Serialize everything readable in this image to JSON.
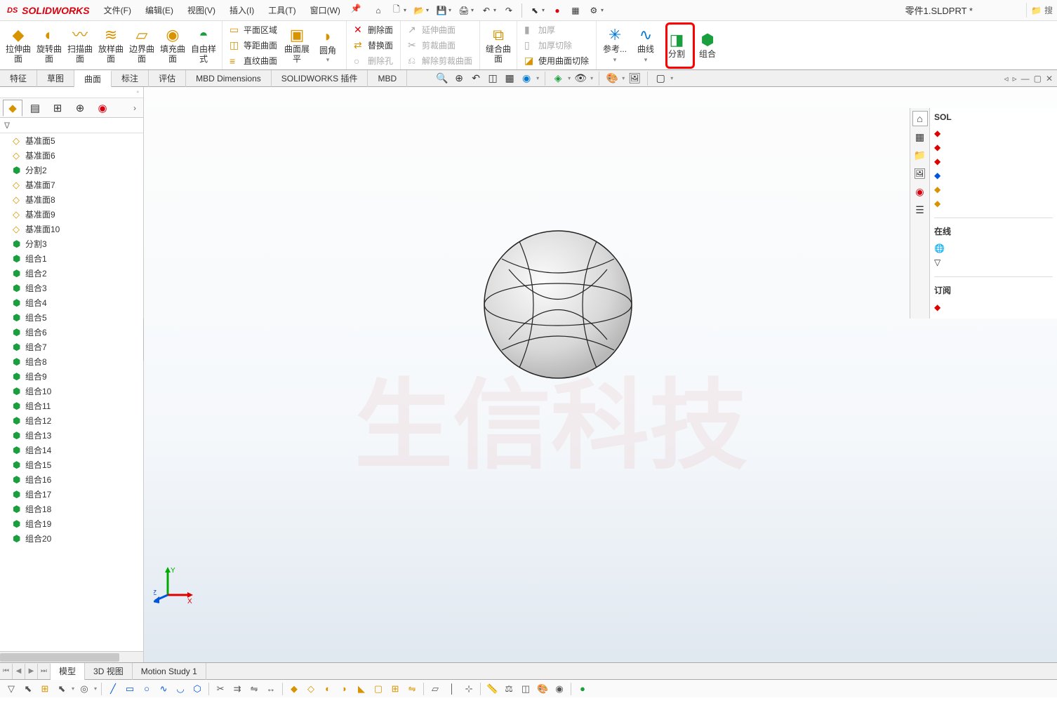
{
  "app": {
    "logo_prefix": "DS",
    "logo_name": "SOLIDWORKS",
    "filename": "零件1.SLDPRT *",
    "search_placeholder": "搜"
  },
  "menus": [
    "文件(F)",
    "编辑(E)",
    "视图(V)",
    "插入(I)",
    "工具(T)",
    "窗口(W)"
  ],
  "ribbon": {
    "group1": [
      {
        "label": "拉伸曲面"
      },
      {
        "label": "旋转曲面"
      },
      {
        "label": "扫描曲面"
      },
      {
        "label": "放样曲面"
      },
      {
        "label": "边界曲面"
      },
      {
        "label": "填充曲面"
      },
      {
        "label": "自由样式"
      }
    ],
    "group2_col": [
      "平面区域",
      "等距曲面",
      "直纹曲面"
    ],
    "group2_big": [
      {
        "label": "曲面展平"
      },
      {
        "label": "圆角"
      }
    ],
    "group3_col": [
      "删除面",
      "替换面",
      "删除孔"
    ],
    "group4_col": [
      "延伸曲面",
      "剪裁曲面",
      "解除剪裁曲面"
    ],
    "group5_big": {
      "label": "缝合曲面"
    },
    "group6_col": [
      "加厚",
      "加厚切除",
      "使用曲面切除"
    ],
    "group7": [
      {
        "label": "参考..."
      },
      {
        "label": "曲线"
      },
      {
        "label": "分割"
      },
      {
        "label": "组合"
      }
    ]
  },
  "cmd_tabs": [
    "特征",
    "草图",
    "曲面",
    "标注",
    "评估",
    "MBD Dimensions",
    "SOLIDWORKS 插件",
    "MBD"
  ],
  "active_cmd_tab": "曲面",
  "tree": [
    {
      "icon": "plane",
      "label": "基准面5"
    },
    {
      "icon": "plane",
      "label": "基准面6"
    },
    {
      "icon": "solid",
      "label": "分割2"
    },
    {
      "icon": "plane",
      "label": "基准面7"
    },
    {
      "icon": "plane",
      "label": "基准面8"
    },
    {
      "icon": "plane",
      "label": "基准面9"
    },
    {
      "icon": "plane",
      "label": "基准面10"
    },
    {
      "icon": "solid",
      "label": "分割3"
    },
    {
      "icon": "solid",
      "label": "组合1"
    },
    {
      "icon": "solid",
      "label": "组合2"
    },
    {
      "icon": "solid",
      "label": "组合3"
    },
    {
      "icon": "solid",
      "label": "组合4"
    },
    {
      "icon": "solid",
      "label": "组合5"
    },
    {
      "icon": "solid",
      "label": "组合6"
    },
    {
      "icon": "solid",
      "label": "组合7"
    },
    {
      "icon": "solid",
      "label": "组合8"
    },
    {
      "icon": "solid",
      "label": "组合9"
    },
    {
      "icon": "solid",
      "label": "组合10"
    },
    {
      "icon": "solid",
      "label": "组合11"
    },
    {
      "icon": "solid",
      "label": "组合12"
    },
    {
      "icon": "solid",
      "label": "组合13"
    },
    {
      "icon": "solid",
      "label": "组合14"
    },
    {
      "icon": "solid",
      "label": "组合15"
    },
    {
      "icon": "solid",
      "label": "组合16"
    },
    {
      "icon": "solid",
      "label": "组合17"
    },
    {
      "icon": "solid",
      "label": "组合18"
    },
    {
      "icon": "solid",
      "label": "组合19"
    },
    {
      "icon": "solid",
      "label": "组合20"
    }
  ],
  "right_pane": {
    "title": "SOL",
    "sections": [
      {
        "title": "在线",
        "items": []
      },
      {
        "title": "订阅",
        "items": []
      }
    ]
  },
  "bottom_tabs": [
    "模型",
    "3D 视图",
    "Motion Study 1"
  ],
  "active_bottom_tab": "模型",
  "triad": {
    "x": "X",
    "y": "Y",
    "z": "Z"
  },
  "highlight_target": "组合"
}
